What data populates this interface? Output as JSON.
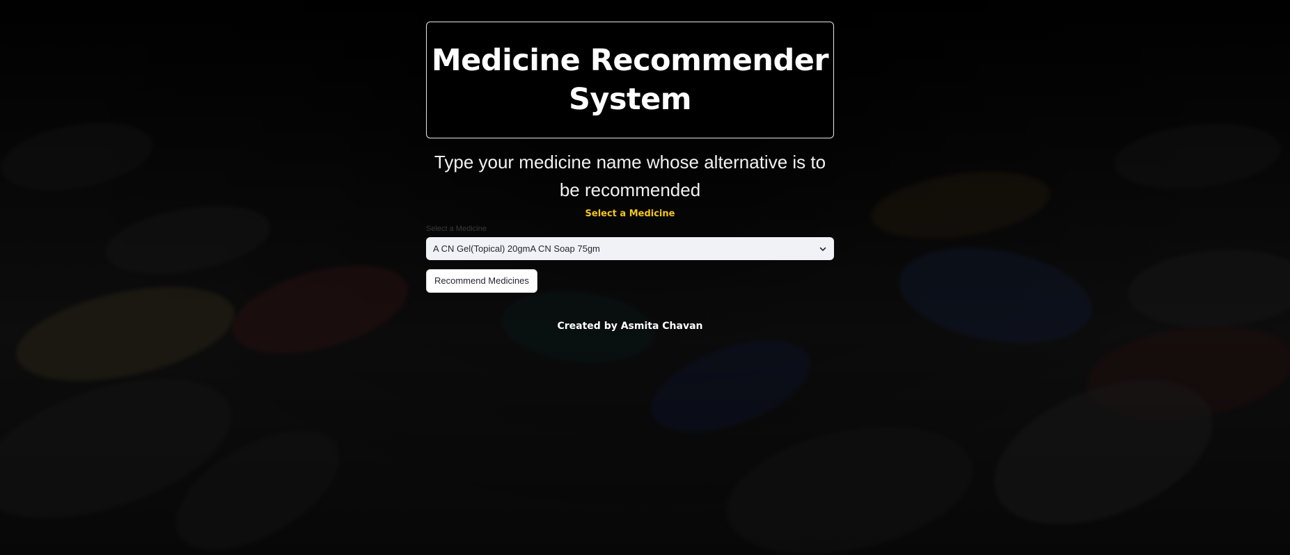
{
  "header": {
    "title": "Medicine Recommender System"
  },
  "main": {
    "subtitle": "Type your medicine name whose alternative is to be recommended",
    "select_heading": "Select a Medicine",
    "select_label": "Select a Medicine",
    "select_value": "A CN Gel(Topical) 20gmA CN Soap 75gm",
    "recommend_button": "Recommend Medicines",
    "accent_color": "#f5c518"
  },
  "footer": {
    "credit": "Created by Asmita Chavan"
  },
  "icons": {
    "select_chevron": "chevron-down-icon"
  }
}
